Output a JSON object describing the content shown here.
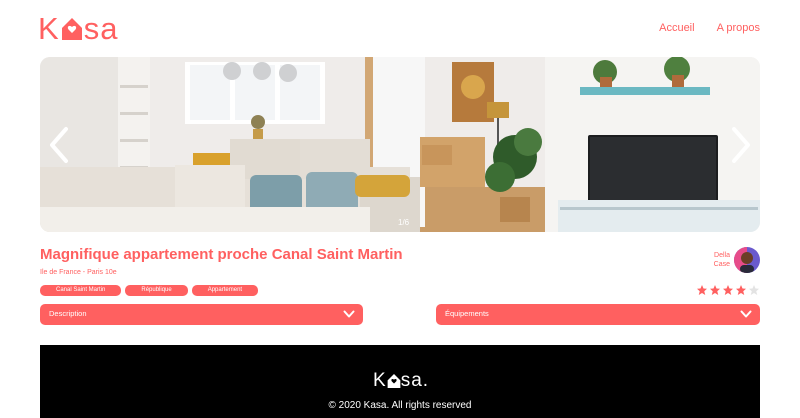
{
  "header": {
    "logo_k": "K",
    "logo_rest": "sa",
    "nav": [
      "Accueil",
      "A propos"
    ]
  },
  "gallery": {
    "counter": "1/6",
    "icons": {
      "previous": "chevron-left-icon",
      "next": "chevron-right-icon"
    }
  },
  "listing": {
    "title": "Magnifique appartement proche Canal Saint Martin",
    "location": "Ile de France - Paris 10e",
    "tags": [
      "Canal Saint Martin",
      "République",
      "Appartement"
    ],
    "host": {
      "first_name": "Della",
      "last_name": "Case"
    },
    "rating": 4,
    "rating_max": 5
  },
  "collapsibles": {
    "description": "Description",
    "equipments": "Équipements"
  },
  "footer": {
    "logo_k": "K",
    "logo_rest": "sa.",
    "copyright": "© 2020 Kasa. All rights reserved"
  },
  "colors": {
    "accent": "#FF6060",
    "star_empty": "#E3E3E3",
    "footer_bg": "#000000"
  }
}
